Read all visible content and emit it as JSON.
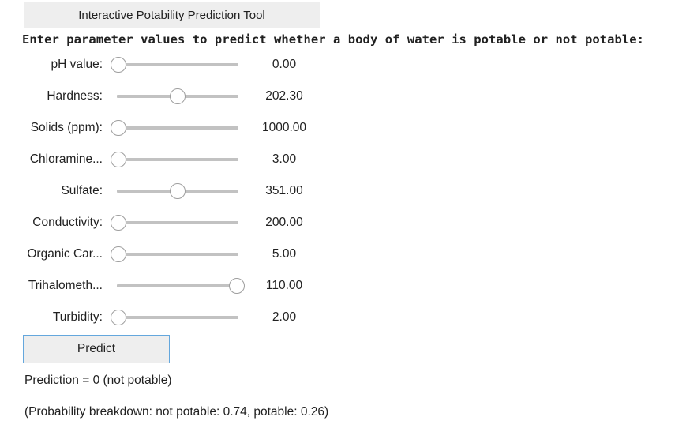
{
  "title": "Interactive Potability Prediction Tool",
  "instruction": "Enter parameter values to predict whether a body of water is potable or not potable:",
  "sliders": [
    {
      "label": "pH value:",
      "value": "0.00",
      "fraction": 0.0
    },
    {
      "label": "Hardness:",
      "value": "202.30",
      "fraction": 0.5
    },
    {
      "label": "Solids (ppm):",
      "value": "1000.00",
      "fraction": 0.0
    },
    {
      "label": "Chloramine...",
      "value": "3.00",
      "fraction": 0.0
    },
    {
      "label": "Sulfate:",
      "value": "351.00",
      "fraction": 0.5
    },
    {
      "label": "Conductivity:",
      "value": "200.00",
      "fraction": 0.0
    },
    {
      "label": "Organic Car...",
      "value": "5.00",
      "fraction": 0.0
    },
    {
      "label": "Trihalometh...",
      "value": "110.00",
      "fraction": 1.0
    },
    {
      "label": "Turbidity:",
      "value": "2.00",
      "fraction": 0.0
    }
  ],
  "predict_label": "Predict",
  "prediction_text": "Prediction = 0 (not potable)",
  "probability_text": "(Probability breakdown: not potable: 0.74, potable: 0.26)"
}
